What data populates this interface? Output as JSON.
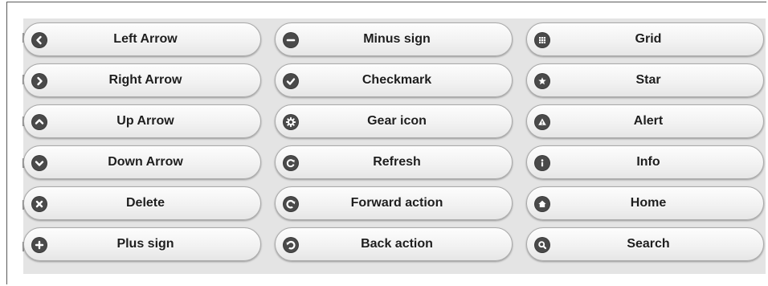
{
  "buttons": {
    "left_arrow": {
      "label": "Left Arrow",
      "icon": "chevron-left-icon"
    },
    "right_arrow": {
      "label": "Right Arrow",
      "icon": "chevron-right-icon"
    },
    "up_arrow": {
      "label": "Up Arrow",
      "icon": "chevron-up-icon"
    },
    "down_arrow": {
      "label": "Down Arrow",
      "icon": "chevron-down-icon"
    },
    "delete": {
      "label": "Delete",
      "icon": "delete-icon"
    },
    "plus": {
      "label": "Plus sign",
      "icon": "plus-icon"
    },
    "minus": {
      "label": "Minus sign",
      "icon": "minus-icon"
    },
    "checkmark": {
      "label": "Checkmark",
      "icon": "checkmark-icon"
    },
    "gear": {
      "label": "Gear icon",
      "icon": "gear-icon"
    },
    "refresh": {
      "label": "Refresh",
      "icon": "refresh-icon"
    },
    "forward": {
      "label": "Forward action",
      "icon": "forward-icon"
    },
    "back": {
      "label": "Back action",
      "icon": "back-icon"
    },
    "grid": {
      "label": "Grid",
      "icon": "grid-icon"
    },
    "star": {
      "label": "Star",
      "icon": "star-icon"
    },
    "alert": {
      "label": "Alert",
      "icon": "alert-icon"
    },
    "info": {
      "label": "Info",
      "icon": "info-icon"
    },
    "home": {
      "label": "Home",
      "icon": "home-icon"
    },
    "search": {
      "label": "Search",
      "icon": "search-icon"
    }
  },
  "colors": {
    "panel_bg": "#e4e4e4",
    "icon_bg": "#4a4a4a",
    "label_text": "#1e1e1e"
  }
}
